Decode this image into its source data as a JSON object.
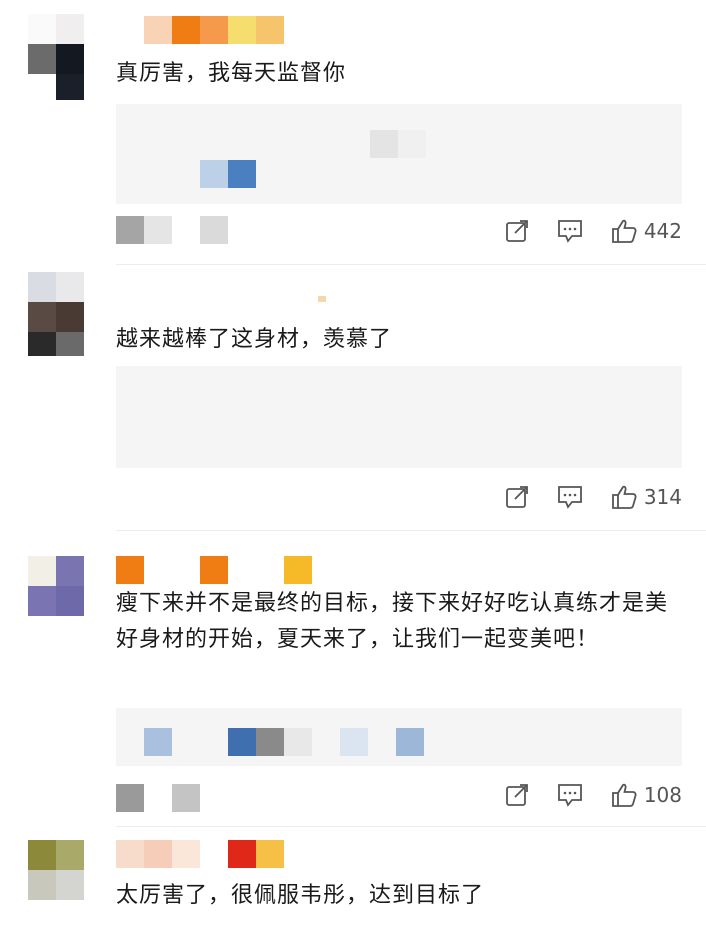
{
  "comments": [
    {
      "text": "真厉害，我每天监督你",
      "likes": "442"
    },
    {
      "text": "越来越棒了这身材，羡慕了",
      "likes": "314"
    },
    {
      "text": "瘦下来并不是最终的目标，接下来好好吃认真练才是美好身材的开始，夏天来了，让我们一起变美吧！",
      "likes": "108"
    },
    {
      "text": "太厉害了，很佩服韦彤，达到目标了",
      "likes": ""
    }
  ],
  "icons": {
    "share": "share-icon",
    "reply": "comment-icon",
    "like": "thumbs-up-icon"
  },
  "colors": {
    "action_gray": "#555555",
    "quote_bg": "#f5f5f5"
  }
}
